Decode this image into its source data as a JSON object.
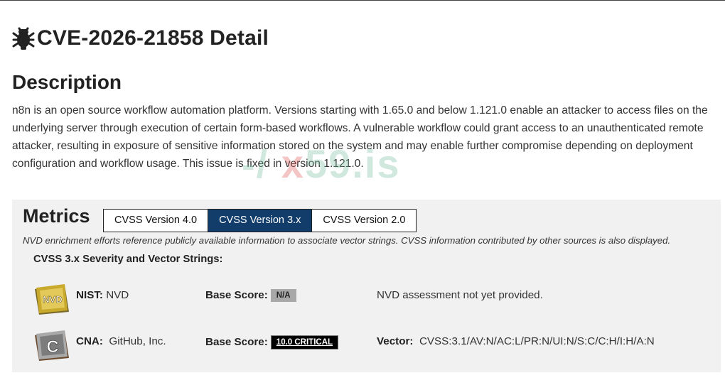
{
  "page": {
    "title": "CVE-2026-21858 Detail",
    "title_icon": "bug-icon"
  },
  "description": {
    "heading": "Description",
    "text": "n8n is an open source workflow automation platform. Versions starting with 1.65.0 and below 1.121.0 enable an attacker to access files on the underlying server through execution of certain form-based workflows. A vulnerable workflow could grant access to an unauthenticated remote attacker, resulting in exposure of sensitive information stored on the system and may enable further compromise depending on deployment configuration and workflow usage. This issue is fixed in version 1.121.0."
  },
  "watermark": {
    "text_a": "-/",
    "text_x": "x",
    "text_b": "59.is"
  },
  "metrics": {
    "heading": "Metrics",
    "tabs": [
      {
        "label": "CVSS Version 4.0",
        "active": false
      },
      {
        "label": "CVSS Version 3.x",
        "active": true
      },
      {
        "label": "CVSS Version 2.0",
        "active": false
      }
    ],
    "note": "NVD enrichment efforts reference publicly available information to associate vector strings. CVSS information contributed by other sources is also displayed.",
    "subheading": "CVSS 3.x Severity and Vector Strings:",
    "rows": [
      {
        "logo_text": "NVD",
        "source_label": "NIST:",
        "source_value": "NVD",
        "score_label": "Base Score:",
        "score_badge": "N/A",
        "extra_label": "",
        "extra_value": "NVD assessment not yet provided."
      },
      {
        "logo_text": "C",
        "source_label": "CNA:",
        "source_value": "GitHub, Inc.",
        "score_label": "Base Score:",
        "score_badge": "10.0 CRITICAL",
        "extra_label": "Vector:",
        "extra_value": "CVSS:3.1/AV:N/AC:L/PR:N/UI:N/S:C/C:H/I:H/A:N"
      }
    ]
  },
  "colors": {
    "active_tab": "#123d6b",
    "panel_bg": "#f1f1f1",
    "critical_badge": "#000000",
    "na_badge": "#a8a8a8"
  }
}
